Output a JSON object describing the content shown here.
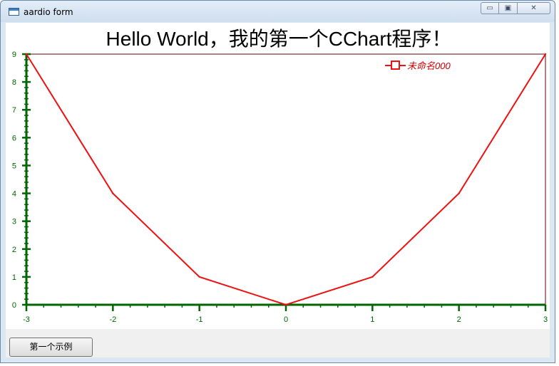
{
  "window": {
    "title": "aardio form",
    "caption": {
      "minimize": "▭",
      "maximize": "▣",
      "close": "✕"
    }
  },
  "button": {
    "label": "第一个示例"
  },
  "colors": {
    "series": "#ee1111",
    "axis": "#006600",
    "plot_border": "#660000",
    "legend_text": "#cc0000"
  },
  "chart_data": {
    "type": "line",
    "title": "Hello World，我的第一个CChart程序！",
    "xlabel": "",
    "ylabel": "",
    "xlim": [
      -3,
      3
    ],
    "ylim": [
      0,
      9
    ],
    "x_ticks": [
      "-3",
      "-2",
      "-1",
      "0",
      "1",
      "2",
      "3"
    ],
    "y_ticks": [
      "0",
      "1",
      "2",
      "3",
      "4",
      "5",
      "6",
      "7",
      "8",
      "9"
    ],
    "grid": false,
    "legend_position": "top-right",
    "series": [
      {
        "name": "未命名000",
        "x": [
          -3,
          -2,
          -1,
          0,
          1,
          2,
          3
        ],
        "y": [
          9,
          4,
          1,
          0,
          1,
          4,
          9
        ]
      }
    ]
  }
}
